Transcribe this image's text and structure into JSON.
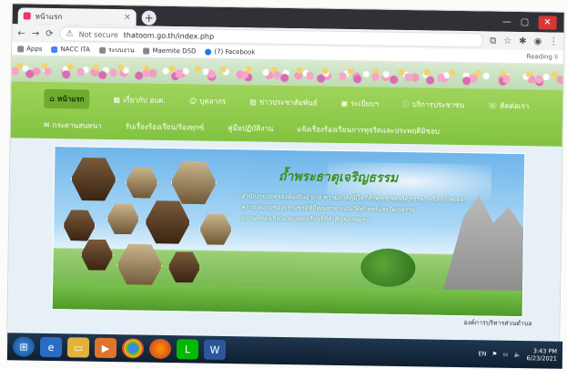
{
  "browser": {
    "tab_title": "หน้าแรก",
    "tab_close": "×",
    "new_tab": "+",
    "security_text": "Not secure",
    "url": "thatoom.go.th/index.php",
    "bookmarks": [
      "Apps",
      "NACC ITA",
      "ระบบงาน",
      "Maemite DSD",
      "(7) Facebook"
    ],
    "reading_list": "Reading li"
  },
  "menu": {
    "row1": [
      "หน้าแรก",
      "เกี่ยวกับ อบต.",
      "บุคลากร",
      "ข่าวประชาสัมพันธ์",
      "ระเบียบฯ",
      "บริการประชาชน",
      "ติดต่อเรา"
    ],
    "row2": [
      "กระดานสนทนา",
      "รับเรื่องร้องเรียน/ร้องทุกข์",
      "คู่มือปฏิบัติงาน",
      "แจ้งเรื่องร้องเรียนการทุจริตและประพฤติมิชอบ"
    ]
  },
  "banner": {
    "title": "ถ้ำพระธาตุเจริญธรรม",
    "line1": "สำนักงานปกครองท้องถิ่นอำเภอ ความภาคภูมิใจ \"ถ้ำพระธาตุเจริญธรรม\" หรือ \"ถ้ำพุเตย\"",
    "line2": "ความงดงามของธรรมชาติที่มีคุณค่าทางประวัติศาสตร์และวัฒนธรรม",
    "line3": "สถานที่ท่องเที่ยวและแหล่งเรียนรู้ที่สำคัญของชุมชน"
  },
  "caption": "องค์การบริหารส่วนตำบล",
  "taskbar": {
    "tray_lang": "EN",
    "time": "3:43 PM",
    "date": "6/23/2021"
  }
}
